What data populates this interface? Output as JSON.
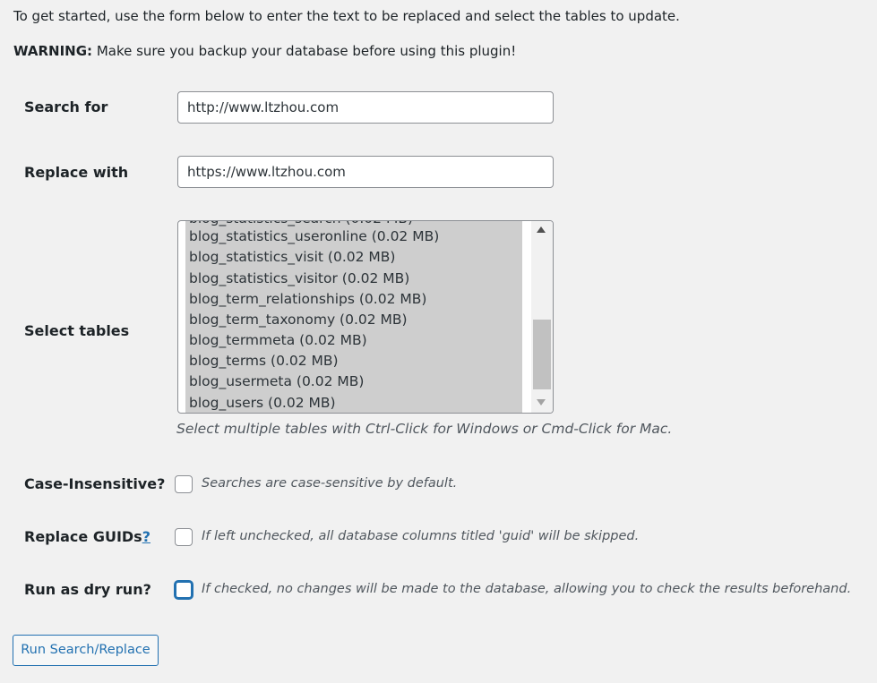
{
  "intro": {
    "text": "To get started, use the form below to enter the text to be replaced and select the tables to update.",
    "warning_label": "WARNING:",
    "warning_text": "Make sure you backup your database before using this plugin!"
  },
  "search": {
    "label": "Search for",
    "value": "http://www.ltzhou.com"
  },
  "replace": {
    "label": "Replace with",
    "value": "https://www.ltzhou.com"
  },
  "tables": {
    "label": "Select tables",
    "options": [
      "blog_statistics_useronline (0.02 MB)",
      "blog_statistics_visit (0.02 MB)",
      "blog_statistics_visitor (0.02 MB)",
      "blog_term_relationships (0.02 MB)",
      "blog_term_taxonomy (0.02 MB)",
      "blog_termmeta (0.02 MB)",
      "blog_terms (0.02 MB)",
      "blog_usermeta (0.02 MB)",
      "blog_users (0.02 MB)"
    ],
    "description": "Select multiple tables with Ctrl-Click for Windows or Cmd-Click for Mac."
  },
  "case_insensitive": {
    "label": "Case-Insensitive?",
    "checked": false,
    "description": "Searches are case-sensitive by default."
  },
  "replace_guids": {
    "label": "Replace GUIDs",
    "help_link": "?",
    "checked": false,
    "description": "If left unchecked, all database columns titled 'guid' will be skipped."
  },
  "dry_run": {
    "label": "Run as dry run?",
    "checked": false,
    "description": "If checked, no changes will be made to the database, allowing you to check the results beforehand."
  },
  "submit": {
    "label": "Run Search/Replace"
  },
  "colors": {
    "background": "#f1f1f1",
    "accent": "#2271b1",
    "selected_option": "#cecece"
  }
}
